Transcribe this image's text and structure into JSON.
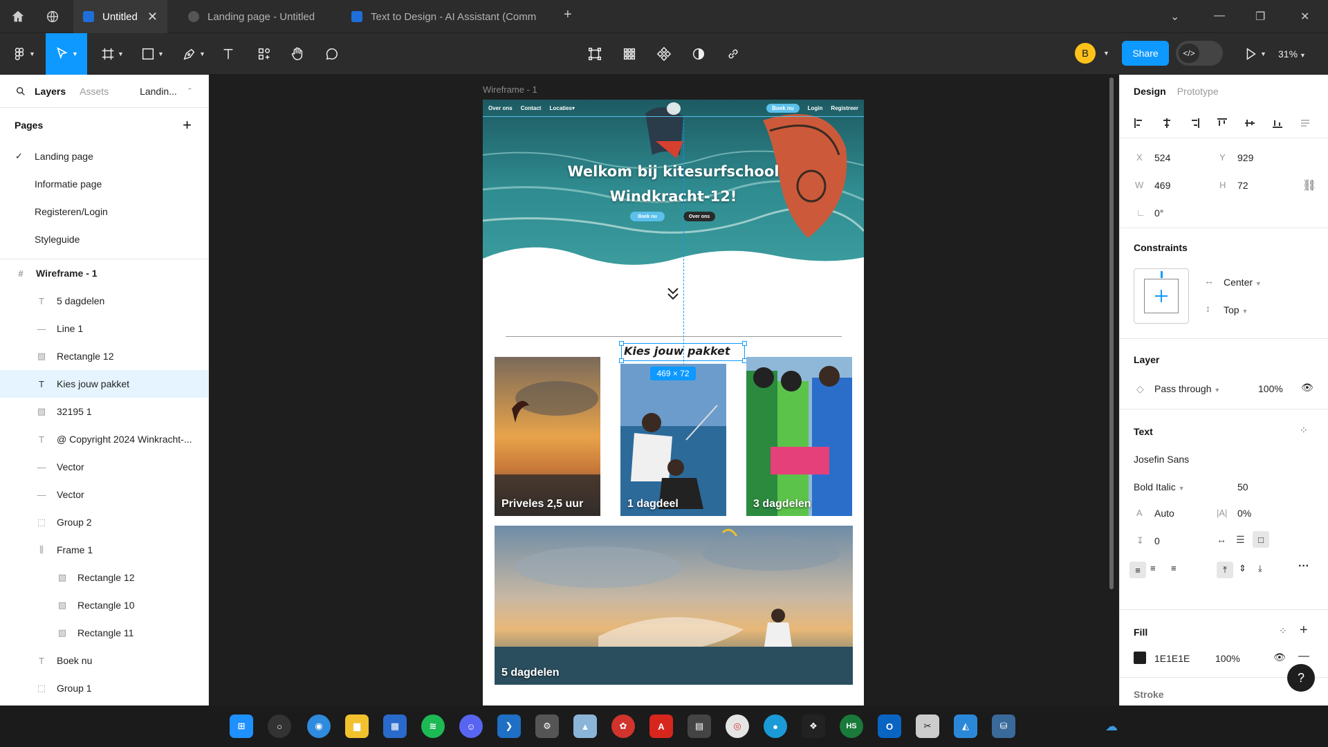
{
  "tabs": [
    {
      "label": "Untitled",
      "active": true
    },
    {
      "label": "Landing page - Untitled",
      "active": false
    },
    {
      "label": "Text to Design - AI Assistant (Comm",
      "active": false
    }
  ],
  "toolbar": {
    "avatar": "B",
    "share": "Share",
    "zoom": "31%"
  },
  "left": {
    "tabs": {
      "layers": "Layers",
      "assets": "Assets",
      "page": "Landin..."
    },
    "pages_title": "Pages",
    "pages": [
      "Landing page",
      "Informatie page",
      "Registeren/Login",
      "Styleguide"
    ],
    "frame": "Wireframe - 1",
    "layers": [
      {
        "name": "5 dagdelen",
        "icon": "text-icon"
      },
      {
        "name": "Line 1",
        "icon": "line-icon"
      },
      {
        "name": "Rectangle 12",
        "icon": "image-icon"
      },
      {
        "name": "Kies jouw pakket",
        "icon": "text-icon"
      },
      {
        "name": "32195 1",
        "icon": "image-icon"
      },
      {
        "name": "@ Copyright 2024 Winkracht-...",
        "icon": "text-icon"
      },
      {
        "name": "Vector",
        "icon": "line-icon"
      },
      {
        "name": "Vector",
        "icon": "line-icon"
      },
      {
        "name": "Group 2",
        "icon": "group-icon"
      },
      {
        "name": "Frame 1",
        "icon": "autolayout-icon"
      },
      {
        "name": "Rectangle 12",
        "icon": "image-icon"
      },
      {
        "name": "Rectangle 10",
        "icon": "image-icon"
      },
      {
        "name": "Rectangle 11",
        "icon": "image-icon"
      },
      {
        "name": "Boek nu",
        "icon": "text-icon"
      },
      {
        "name": "Group 1",
        "icon": "group-icon"
      }
    ]
  },
  "canvas": {
    "frame_label": "Wireframe - 1",
    "nav": {
      "links": [
        "Over ons",
        "Contact",
        "Locaties"
      ],
      "cta": "Boek nu",
      "login": "Login",
      "register": "Registreer"
    },
    "hero": {
      "line1": "Welkom bij kitesurfschool",
      "line2": "Windkracht-12!",
      "btn1": "Boek nu",
      "btn2": "Over ons"
    },
    "selected_text": "Kies jouw pakket",
    "dims": "469 × 72",
    "cards": [
      "Priveles 2,5 uur",
      "1 dagdeel",
      "3 dagdelen",
      "5 dagdelen"
    ]
  },
  "design": {
    "tabs": {
      "design": "Design",
      "prototype": "Prototype"
    },
    "x": "524",
    "y": "929",
    "w": "469",
    "h": "72",
    "rotation": "0°",
    "constraints": {
      "title": "Constraints",
      "h": "Center",
      "v": "Top"
    },
    "layer": {
      "title": "Layer",
      "blend": "Pass through",
      "opacity": "100%"
    },
    "text": {
      "title": "Text",
      "font": "Josefin Sans",
      "style": "Bold Italic",
      "size": "50",
      "line_height": "Auto",
      "letter_spacing": "0%",
      "paragraph": "0"
    },
    "fill": {
      "title": "Fill",
      "hex": "1E1E1E",
      "opacity": "100%"
    },
    "stroke": {
      "title": "Stroke"
    }
  },
  "colors": {
    "accent": "#0d99ff",
    "fill": "#1E1E1E",
    "avatar": "#ffc21a"
  }
}
